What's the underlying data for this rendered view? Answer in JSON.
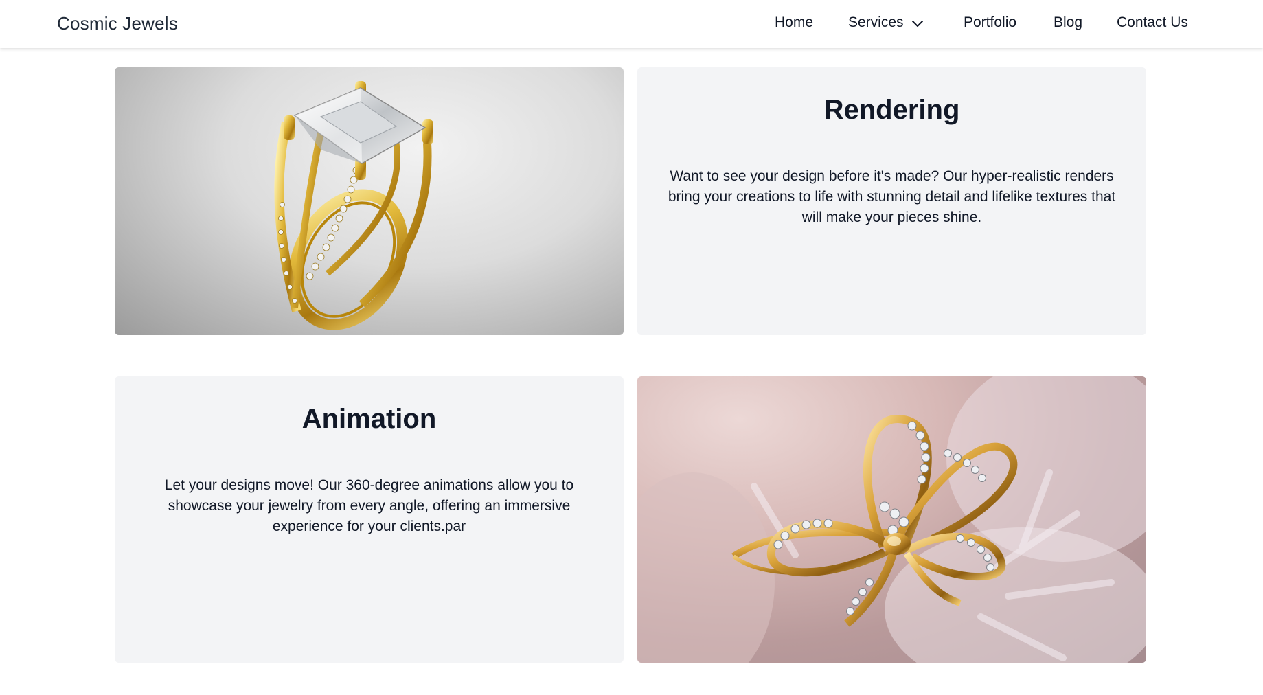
{
  "navbar": {
    "brand": "Cosmic Jewels",
    "links": {
      "home": "Home",
      "services": "Services",
      "portfolio": "Portfolio",
      "blog": "Blog",
      "contact": "Contact Us"
    },
    "services_icon": "chevron-down-icon"
  },
  "services": [
    {
      "title": "Rendering",
      "description": "Want to see your design before it's made? Our hyper-realistic renders bring your creations to life with stunning detail and lifelike textures that will make your pieces shine.",
      "image_subject": "gold-diamond-ring-render"
    },
    {
      "title": "Animation",
      "description": "Let your designs move! Our 360-degree animations allow you to showcase your jewelry from every angle, offering an immersive experience for your clients.par",
      "image_subject": "gold-bow-ring-render"
    }
  ],
  "colors": {
    "card_background": "#f3f4f6",
    "text": "#111827",
    "gold": "#d4a72c"
  }
}
